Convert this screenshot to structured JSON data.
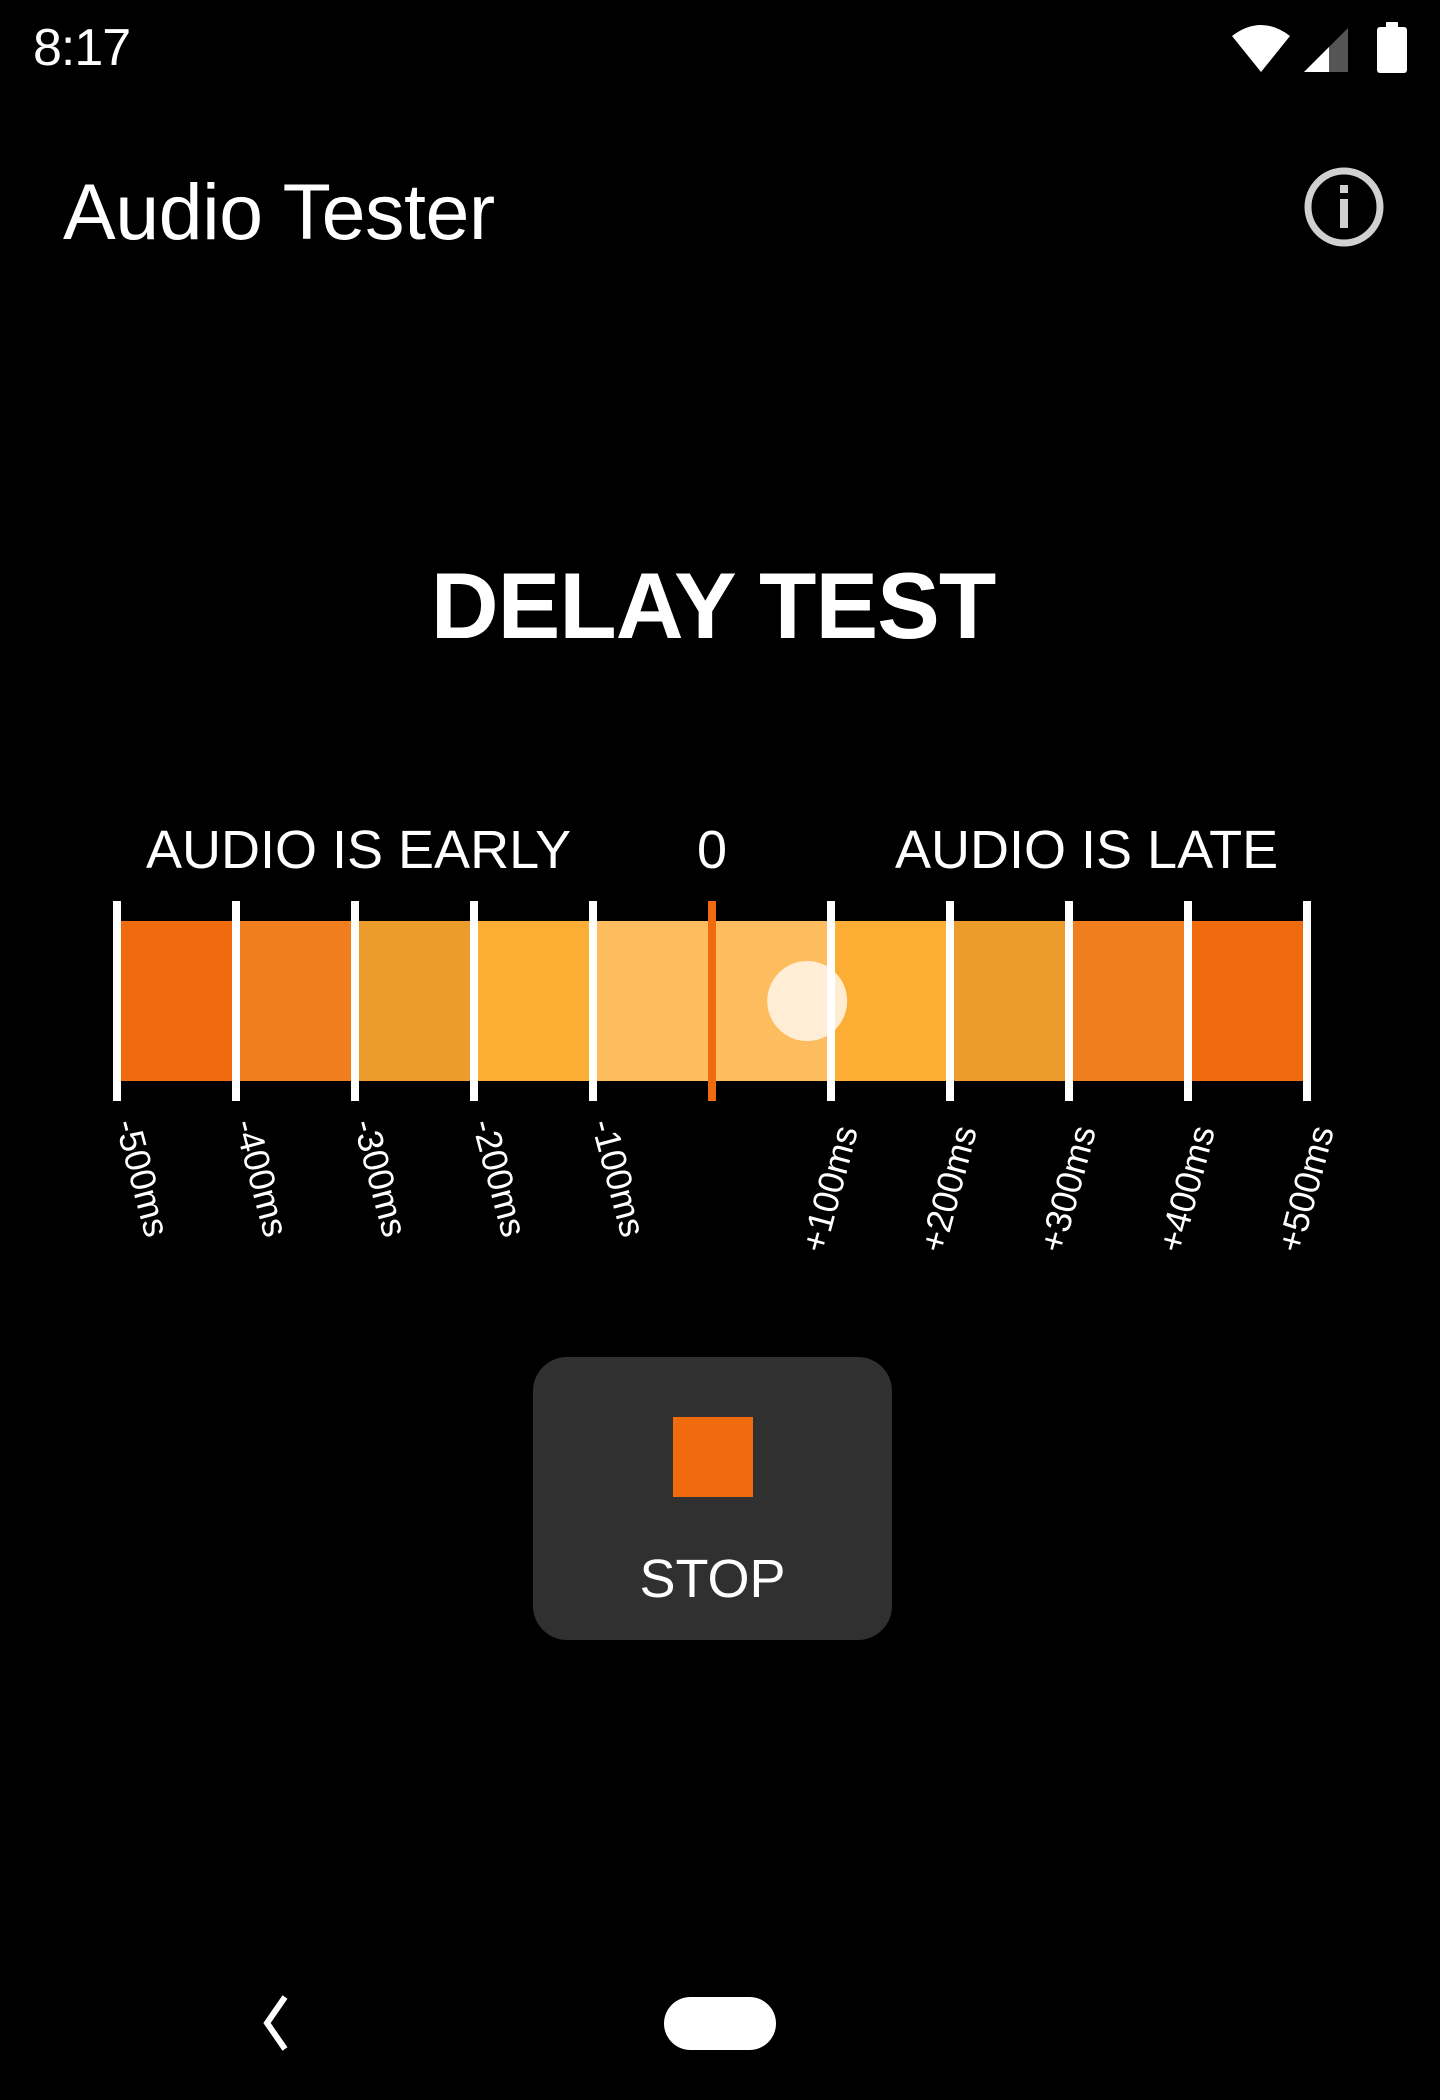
{
  "status_bar": {
    "time": "8:17",
    "icons": [
      "wifi-icon",
      "cell-signal-icon",
      "battery-icon"
    ]
  },
  "app_bar": {
    "title": "Audio Tester",
    "info_icon": "info-icon"
  },
  "test": {
    "title": "DELAY TEST",
    "label_early": "AUDIO IS EARLY",
    "label_zero": "0",
    "label_late": "AUDIO IS LATE"
  },
  "meter": {
    "unit": "ms",
    "min": -500,
    "max": 500,
    "step": 100,
    "ticks": [
      {
        "value": -500,
        "label": "-500ms"
      },
      {
        "value": -400,
        "label": "-400ms"
      },
      {
        "value": -300,
        "label": "-300ms"
      },
      {
        "value": -200,
        "label": "-200ms"
      },
      {
        "value": -100,
        "label": "-100ms"
      },
      {
        "value": 0,
        "label": ""
      },
      {
        "value": 100,
        "label": "+100ms"
      },
      {
        "value": 200,
        "label": "+200ms"
      },
      {
        "value": 300,
        "label": "+300ms"
      },
      {
        "value": 400,
        "label": "+400ms"
      },
      {
        "value": 500,
        "label": "+500ms"
      }
    ],
    "segment_colors": [
      "#f06a0e",
      "#f07d1e",
      "#ec9c2a",
      "#fcae34",
      "#fdbc5e",
      "#fdbc5e",
      "#fcae34",
      "#ec9c2a",
      "#f07d1e",
      "#f06a0e"
    ],
    "center_line_color": "#f06a0e",
    "tick_color": "#ffffff",
    "knob_color": "#fff3e2",
    "indicator_value_ms": 80
  },
  "stop_button": {
    "label": "STOP",
    "icon": "stop-icon",
    "icon_color": "#f06a0e"
  },
  "nav_bar": {
    "back": "back-icon",
    "home": "home-pill"
  }
}
